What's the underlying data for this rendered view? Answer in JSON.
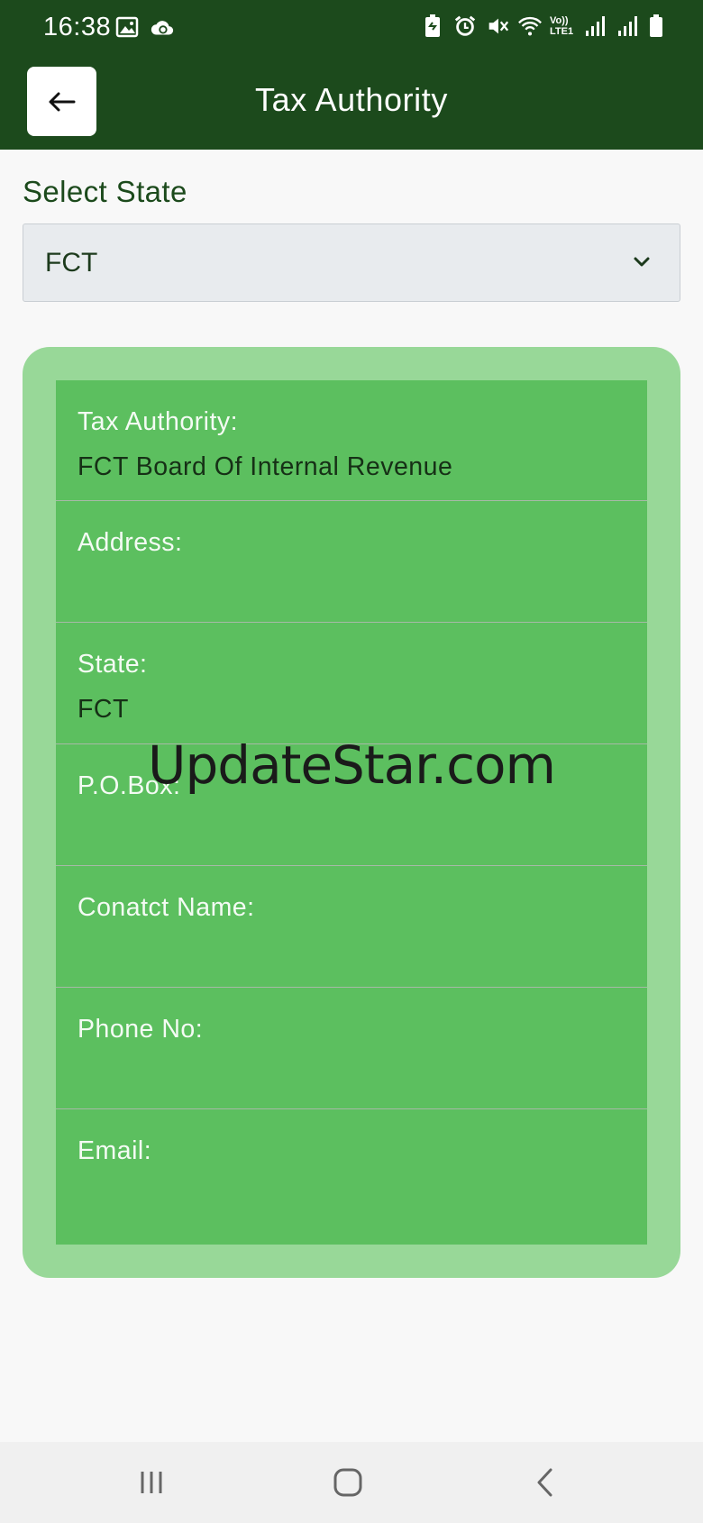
{
  "status_bar": {
    "time": "16:38",
    "left_icons": [
      "image-icon",
      "cloud-sync-icon"
    ],
    "right_icons": [
      "battery-saver-icon",
      "alarm-icon",
      "mute-icon",
      "wifi-icon",
      "volte-icon",
      "signal-icon",
      "signal-icon",
      "battery-icon"
    ],
    "volte_text": "Vo)) LTE1"
  },
  "app_bar": {
    "back_icon": "arrow-left-icon",
    "title": "Tax Authority"
  },
  "state_selector": {
    "label": "Select State",
    "selected_value": "FCT",
    "chevron_icon": "chevron-down-icon"
  },
  "details": [
    {
      "label": "Tax Authority:",
      "value": "FCT Board Of Internal Revenue"
    },
    {
      "label": "Address:",
      "value": ""
    },
    {
      "label": "State:",
      "value": "FCT"
    },
    {
      "label": "P.O.Box:",
      "value": ""
    },
    {
      "label": "Conatct Name:",
      "value": ""
    },
    {
      "label": "Phone No:",
      "value": ""
    },
    {
      "label": "Email:",
      "value": ""
    }
  ],
  "watermark": "UpdateStar.com",
  "nav_bar": {
    "icons": [
      "recent-apps-icon",
      "home-icon",
      "back-icon"
    ]
  },
  "colors": {
    "header": "#1c4a1c",
    "card_outer": "#98d898",
    "card_inner": "#5cbf5f",
    "page_background": "#f8f8f8",
    "select_background": "#e8ebee"
  }
}
